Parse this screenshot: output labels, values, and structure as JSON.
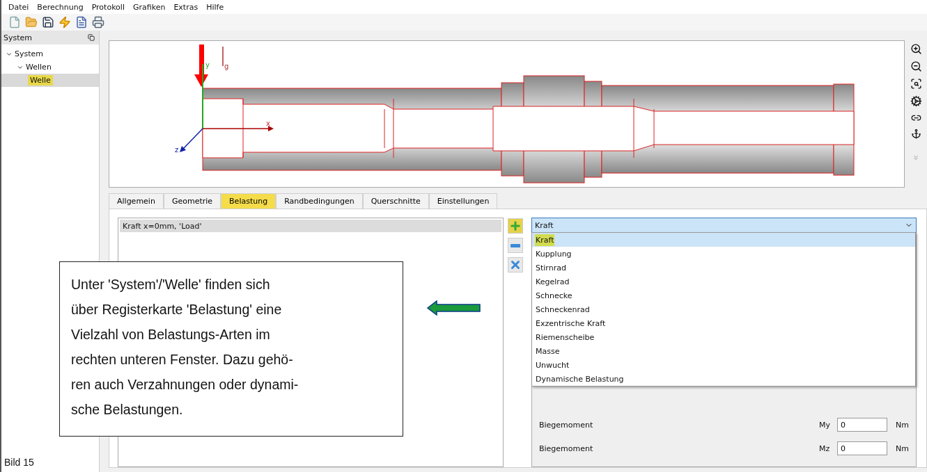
{
  "menu": [
    "Datei",
    "Berechnung",
    "Protokoll",
    "Grafiken",
    "Extras",
    "Hilfe"
  ],
  "sidebar": {
    "title": "System",
    "tree": [
      {
        "label": "System",
        "expanded": true,
        "selected": false,
        "children": [
          {
            "label": "Wellen",
            "expanded": true,
            "selected": false,
            "children": [
              {
                "label": "Welle",
                "selected": true
              }
            ]
          }
        ]
      }
    ]
  },
  "canvas": {
    "axes": {
      "x": "x",
      "z": "z",
      "y": "y",
      "g": "g"
    }
  },
  "tabs": [
    {
      "label": "Allgemein",
      "selected": false
    },
    {
      "label": "Geometrie",
      "selected": false
    },
    {
      "label": "Belastung",
      "selected": true
    },
    {
      "label": "Randbedingungen",
      "selected": false
    },
    {
      "label": "Querschnitte",
      "selected": false
    },
    {
      "label": "Einstellungen",
      "selected": false
    }
  ],
  "loads": [
    {
      "label": "Kraft  x=0mm, 'Load'",
      "selected": true
    }
  ],
  "load_type": {
    "value": "Kraft",
    "options": [
      {
        "label": "Kraft",
        "selected": true
      },
      {
        "label": "Kupplung",
        "selected": false
      },
      {
        "label": "Stirnrad",
        "selected": false
      },
      {
        "label": "Kegelrad",
        "selected": false
      },
      {
        "label": "Schnecke",
        "selected": false
      },
      {
        "label": "Schneckenrad",
        "selected": false
      },
      {
        "label": "Exzentrische Kraft",
        "selected": false
      },
      {
        "label": "Riemenscheibe",
        "selected": false
      },
      {
        "label": "Masse",
        "selected": false
      },
      {
        "label": "Unwucht",
        "selected": false
      },
      {
        "label": "Dynamische Belastung",
        "selected": false
      }
    ]
  },
  "properties": [
    {
      "label": "Biegemoment",
      "symbol": "My",
      "value": "0",
      "unit": "Nm"
    },
    {
      "label": "Biegemoment",
      "symbol": "Mz",
      "value": "0",
      "unit": "Nm"
    }
  ],
  "callout": "Unter 'System'/'Welle' finden sich\nüber Registerkarte 'Belastung' eine\nVielzahl von Belastungs-Arten im\nrechten unteren Fenster. Dazu gehö-\nren auch Verzahnungen oder dynami-\nsche Belastungen.",
  "caption": "Bild 15"
}
